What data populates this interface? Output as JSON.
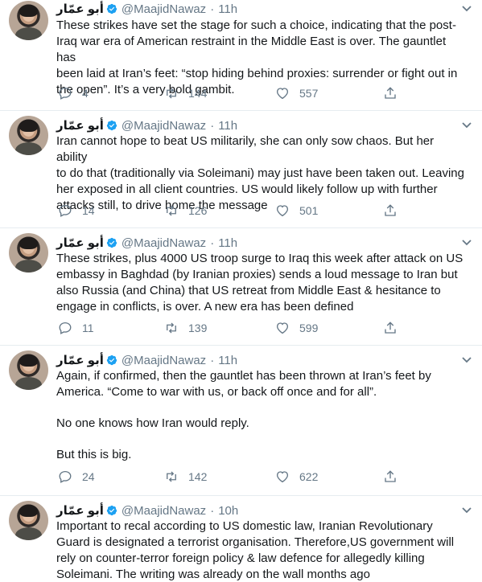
{
  "tweets": [
    {
      "name": "أبو عمّار",
      "handle": "@MaajidNawaz",
      "separator": "·",
      "time": "11h",
      "lines": [
        "These strikes have set the stage for such a choice, indicating that the post-",
        "Iraq war era of American restraint in the Middle East is over. The gauntlet has",
        "been laid at Iran’s feet: “stop hiding behind proxies: surrender or fight out in",
        "the open”. It’s a very bold gambit."
      ],
      "replies": "4",
      "retweets": "144",
      "likes": "557"
    },
    {
      "name": "أبو عمّار",
      "handle": "@MaajidNawaz",
      "separator": "·",
      "time": "11h",
      "lines": [
        "Iran cannot hope to beat US militarily, she can only sow chaos. But her ability",
        "to do that (traditionally via Soleimani) may just have been taken out. Leaving",
        "her exposed in all client countries. US would likely follow up with further",
        "attacks still, to drive home the message"
      ],
      "replies": "14",
      "retweets": "126",
      "likes": "501"
    },
    {
      "name": "أبو عمّار",
      "handle": "@MaajidNawaz",
      "separator": "·",
      "time": "11h",
      "lines": [
        "These strikes, plus 4000 US troop surge to Iraq this week after attack on US",
        "embassy in Baghdad (by Iranian proxies) sends a loud message to Iran but",
        "also Russia (and China) that US retreat from Middle East & hesitance to",
        "engage in conflicts, is over. A new era has been defined"
      ],
      "replies": "11",
      "retweets": "139",
      "likes": "599"
    },
    {
      "name": "أبو عمّار",
      "handle": "@MaajidNawaz",
      "separator": "·",
      "time": "11h",
      "lines": [
        "Again, if confirmed, then the gauntlet has been thrown at Iran’s feet by",
        "America. “Come to war with us, or back off once and for all”.",
        "",
        "No one knows how Iran would reply.",
        "",
        "But this is big."
      ],
      "replies": "24",
      "retweets": "142",
      "likes": "622"
    },
    {
      "name": "أبو عمّار",
      "handle": "@MaajidNawaz",
      "separator": "·",
      "time": "10h",
      "lines": [
        "Important to recal according to US domestic law, Iranian Revolutionary",
        "Guard is designated a terrorist organisation. Therefore,US government will",
        "rely on counter-terror foreign policy & law defence for allegedly killing",
        "Soleimani. The writing was already on the wall months ago"
      ],
      "replies": "",
      "retweets": "",
      "likes": ""
    }
  ]
}
